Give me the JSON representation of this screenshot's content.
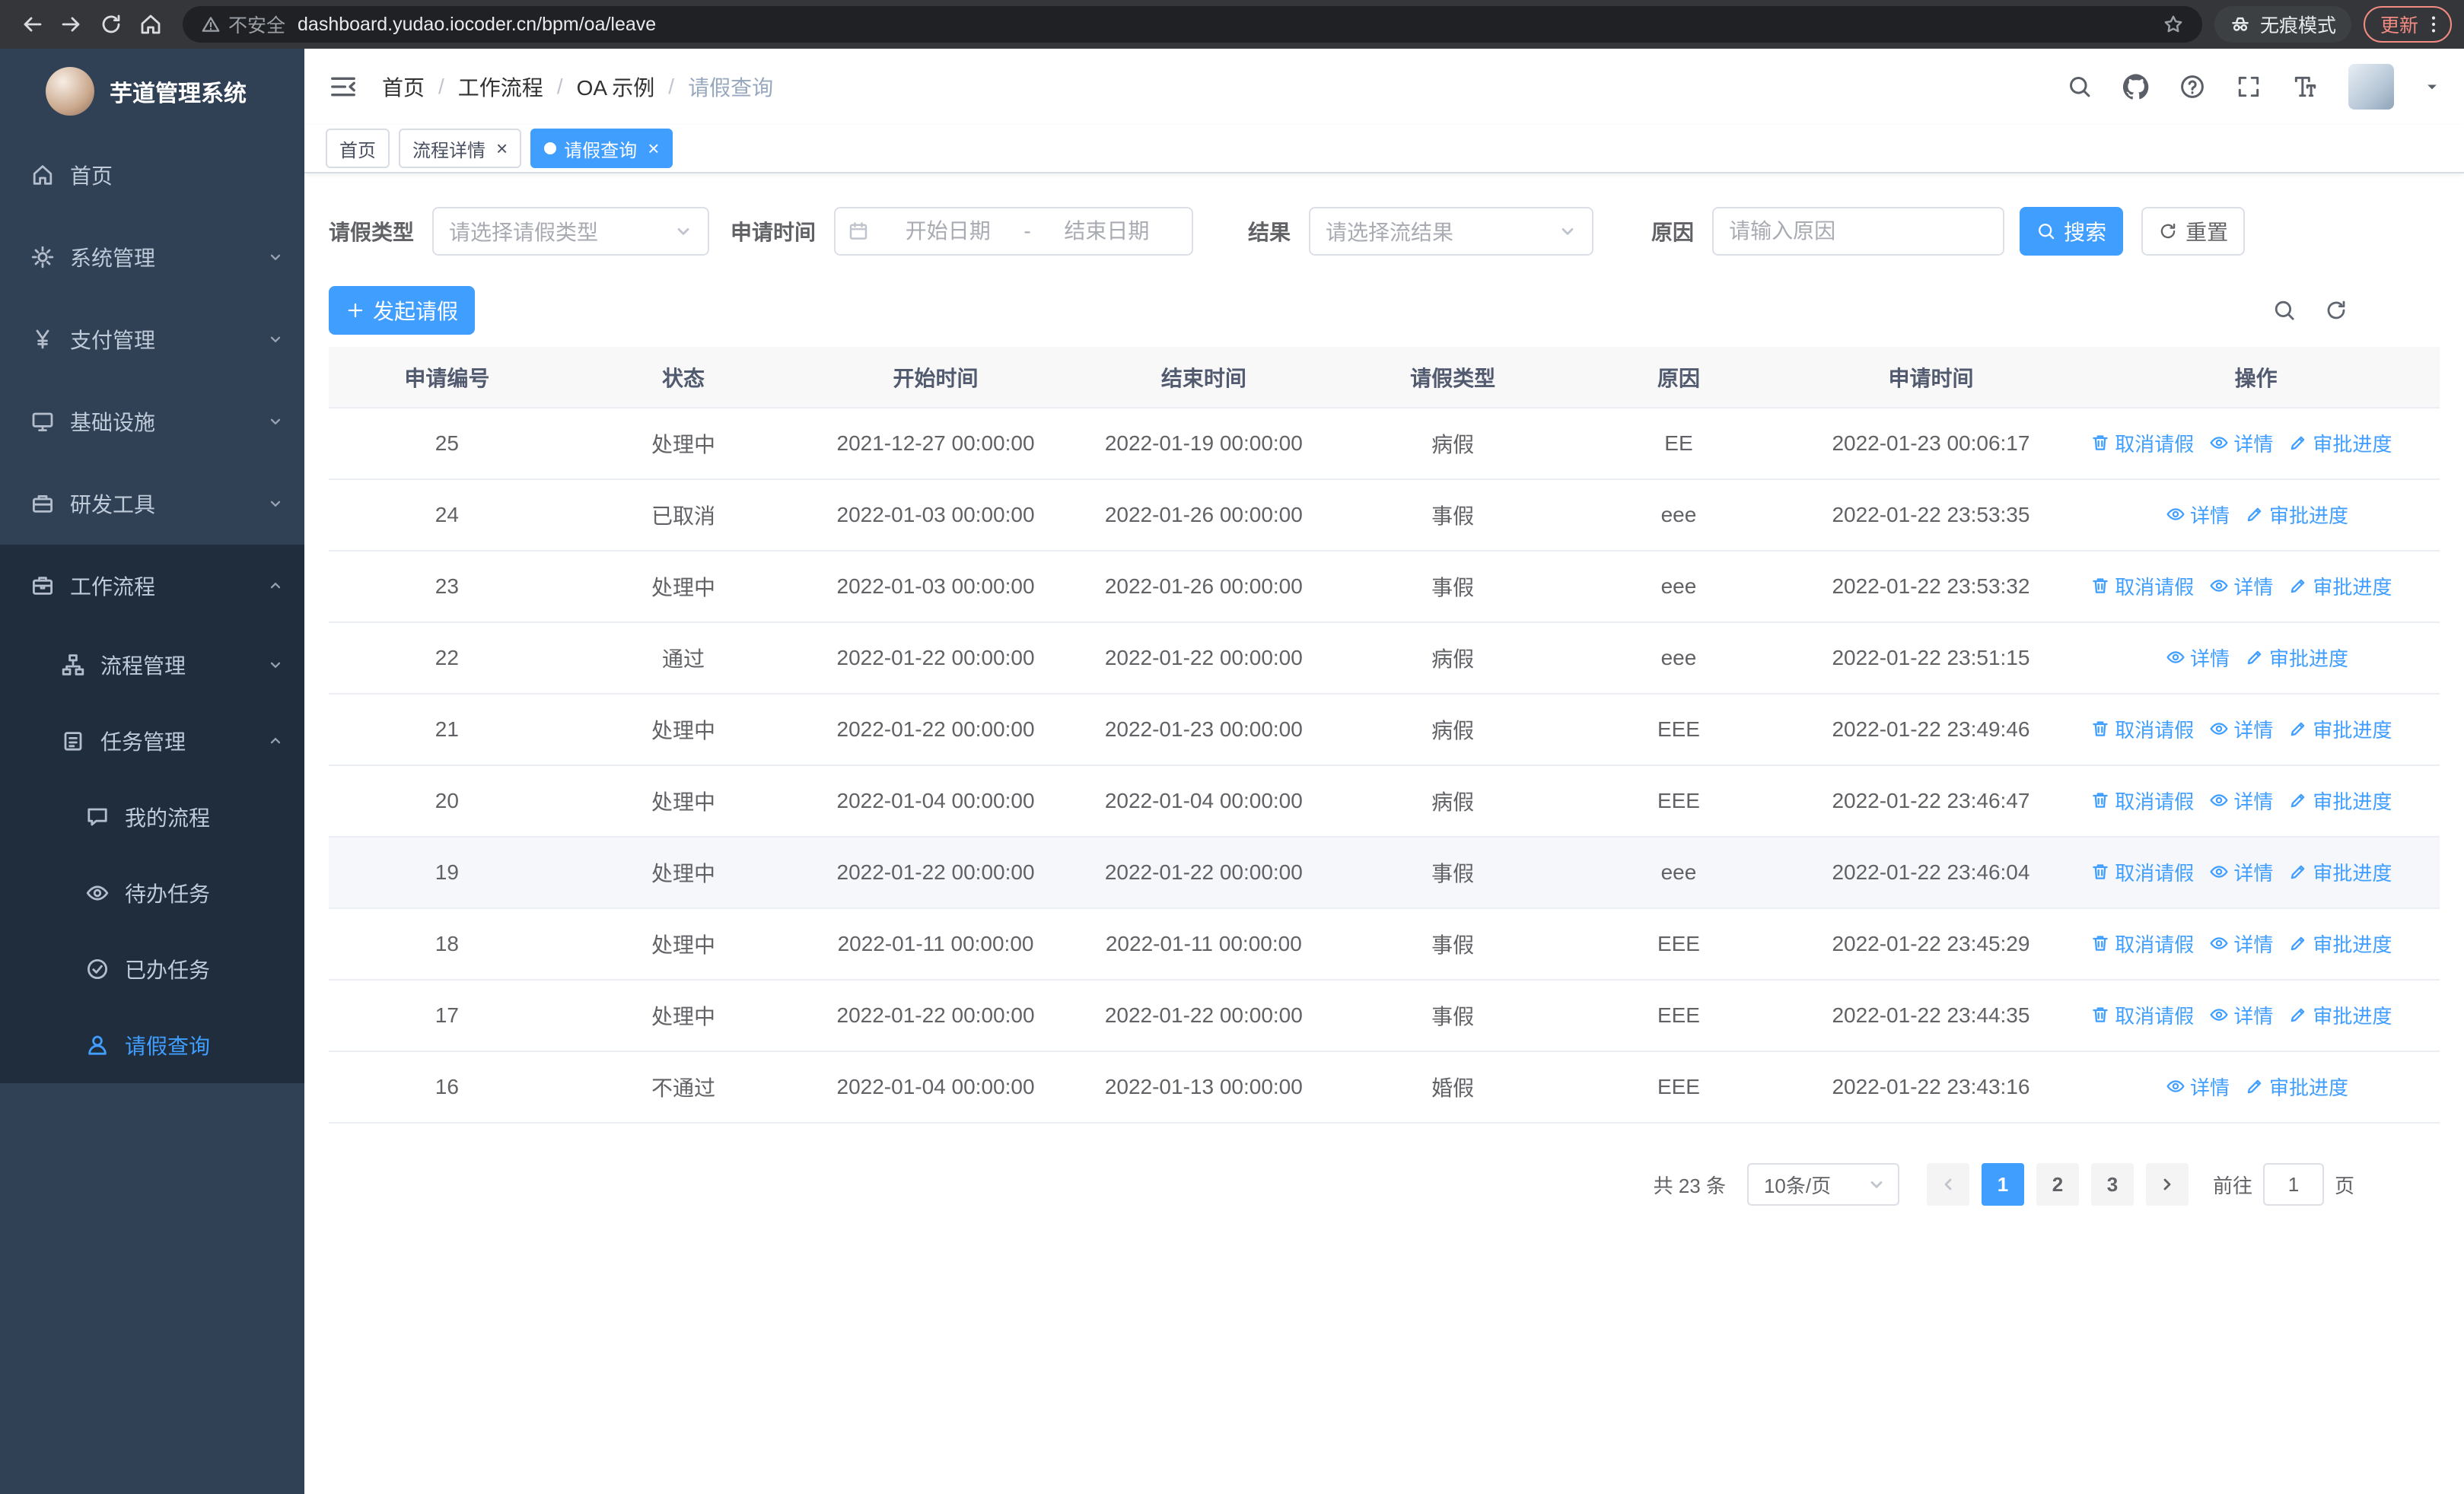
{
  "colors": {
    "accent": "#409eff",
    "sidebar_bg": "#304156",
    "submenu_bg": "#1f2d3d",
    "toolbar_bg": "#35363a",
    "urlbar_bg": "#202124",
    "update_chip": "#f28b82"
  },
  "browser": {
    "security": "不安全",
    "url": "dashboard.yudao.iocoder.cn/bpm/oa/leave",
    "incognito": "无痕模式",
    "update": "更新"
  },
  "sidebar": {
    "title": "芋道管理系统",
    "menu": [
      {
        "name": "home",
        "icon": "home",
        "label": "首页"
      },
      {
        "name": "system-management",
        "icon": "gear",
        "label": "系统管理",
        "chevron": "down"
      },
      {
        "name": "payment-management",
        "icon": "yen",
        "label": "支付管理",
        "chevron": "down"
      },
      {
        "name": "infrastructure",
        "icon": "monitor",
        "label": "基础设施",
        "chevron": "down"
      },
      {
        "name": "dev-tools",
        "icon": "toolbox",
        "label": "研发工具",
        "chevron": "down"
      },
      {
        "name": "workflow",
        "icon": "briefcase",
        "label": "工作流程",
        "chevron": "up",
        "open": true,
        "children": [
          {
            "name": "process-management",
            "icon": "flow",
            "label": "流程管理",
            "chevron": "down"
          },
          {
            "name": "task-management",
            "icon": "clipboard",
            "label": "任务管理",
            "chevron": "up",
            "children": [
              {
                "name": "my-process",
                "icon": "chat",
                "label": "我的流程"
              },
              {
                "name": "todo-tasks",
                "icon": "eye",
                "label": "待办任务"
              },
              {
                "name": "done-tasks",
                "icon": "check",
                "label": "已办任务"
              },
              {
                "name": "leave-query",
                "icon": "user",
                "label": "请假查询",
                "active": true
              }
            ]
          }
        ]
      }
    ]
  },
  "header": {
    "breadcrumb": [
      "首页",
      "工作流程",
      "OA 示例",
      "请假查询"
    ]
  },
  "tabs": [
    {
      "name": "home",
      "label": "首页"
    },
    {
      "name": "process-detail",
      "label": "流程详情",
      "closable": true
    },
    {
      "name": "leave-query",
      "label": "请假查询",
      "closable": true,
      "active": true
    }
  ],
  "filters": {
    "type_label": "请假类型",
    "type_placeholder": "请选择请假类型",
    "time_label": "申请时间",
    "start_placeholder": "开始日期",
    "separator": "-",
    "end_placeholder": "结束日期",
    "result_label": "结果",
    "result_placeholder": "请选择流结果",
    "reason_label": "原因",
    "reason_placeholder": "请输入原因",
    "search": "搜索",
    "reset": "重置"
  },
  "toolbar": {
    "create": "发起请假"
  },
  "table": {
    "columns": [
      "申请编号",
      "状态",
      "开始时间",
      "结束时间",
      "请假类型",
      "原因",
      "申请时间",
      "操作"
    ],
    "actions": {
      "cancel": "取消请假",
      "detail": "详情",
      "progress": "审批进度"
    },
    "rows": [
      {
        "id": "25",
        "status": "处理中",
        "start": "2021-12-27 00:00:00",
        "end": "2022-01-19 00:00:00",
        "type": "病假",
        "reason": "EE",
        "applied": "2022-01-23 00:06:17",
        "cancellable": true
      },
      {
        "id": "24",
        "status": "已取消",
        "start": "2022-01-03 00:00:00",
        "end": "2022-01-26 00:00:00",
        "type": "事假",
        "reason": "eee",
        "applied": "2022-01-22 23:53:35",
        "cancellable": false
      },
      {
        "id": "23",
        "status": "处理中",
        "start": "2022-01-03 00:00:00",
        "end": "2022-01-26 00:00:00",
        "type": "事假",
        "reason": "eee",
        "applied": "2022-01-22 23:53:32",
        "cancellable": true
      },
      {
        "id": "22",
        "status": "通过",
        "start": "2022-01-22 00:00:00",
        "end": "2022-01-22 00:00:00",
        "type": "病假",
        "reason": "eee",
        "applied": "2022-01-22 23:51:15",
        "cancellable": false
      },
      {
        "id": "21",
        "status": "处理中",
        "start": "2022-01-22 00:00:00",
        "end": "2022-01-23 00:00:00",
        "type": "病假",
        "reason": "EEE",
        "applied": "2022-01-22 23:49:46",
        "cancellable": true
      },
      {
        "id": "20",
        "status": "处理中",
        "start": "2022-01-04 00:00:00",
        "end": "2022-01-04 00:00:00",
        "type": "病假",
        "reason": "EEE",
        "applied": "2022-01-22 23:46:47",
        "cancellable": true
      },
      {
        "id": "19",
        "status": "处理中",
        "start": "2022-01-22 00:00:00",
        "end": "2022-01-22 00:00:00",
        "type": "事假",
        "reason": "eee",
        "applied": "2022-01-22 23:46:04",
        "cancellable": true,
        "highlight": true
      },
      {
        "id": "18",
        "status": "处理中",
        "start": "2022-01-11 00:00:00",
        "end": "2022-01-11 00:00:00",
        "type": "事假",
        "reason": "EEE",
        "applied": "2022-01-22 23:45:29",
        "cancellable": true
      },
      {
        "id": "17",
        "status": "处理中",
        "start": "2022-01-22 00:00:00",
        "end": "2022-01-22 00:00:00",
        "type": "事假",
        "reason": "EEE",
        "applied": "2022-01-22 23:44:35",
        "cancellable": true
      },
      {
        "id": "16",
        "status": "不通过",
        "start": "2022-01-04 00:00:00",
        "end": "2022-01-13 00:00:00",
        "type": "婚假",
        "reason": "EEE",
        "applied": "2022-01-22 23:43:16",
        "cancellable": false
      }
    ]
  },
  "pagination": {
    "total": "共 23 条",
    "page_size": "10条/页",
    "pages": [
      "1",
      "2",
      "3"
    ],
    "active": "1",
    "goto": "前往",
    "goto_value": "1",
    "unit": "页"
  }
}
